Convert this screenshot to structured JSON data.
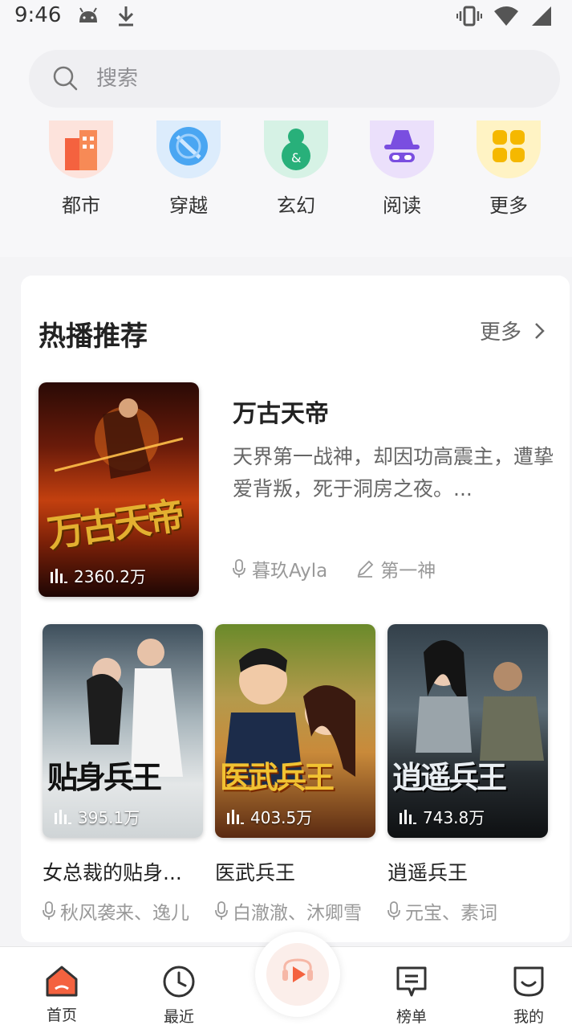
{
  "status_bar": {
    "time": "9:46"
  },
  "search": {
    "placeholder": "搜索"
  },
  "categories": [
    {
      "label": "都市",
      "icon": "city-building-icon",
      "color": "#f4623f"
    },
    {
      "label": "穿越",
      "icon": "time-travel-swirl-icon",
      "color": "#3f9ef0"
    },
    {
      "label": "玄幻",
      "icon": "gourd-icon",
      "color": "#28b07a"
    },
    {
      "label": "阅读",
      "icon": "spy-hat-icon",
      "color": "#7a4ee0"
    },
    {
      "label": "更多",
      "icon": "more-grid-icon",
      "color": "#f5b800"
    }
  ],
  "hot": {
    "title": "热播推荐",
    "more_label": "更多",
    "featured": {
      "title": "万古天帝",
      "description": "天界第一战神，却因功高震主，遭挚爱背叛，死于洞房之夜。...",
      "play_count": "2360.2万",
      "narrator": "暮玖Ayla",
      "author": "第一神"
    },
    "books": [
      {
        "title": "女总裁的贴身...",
        "play_count": "395.1万",
        "authors": "秋风袭来、逸儿"
      },
      {
        "title": "医武兵王",
        "play_count": "403.5万",
        "authors": "白澈澈、沐卿雪"
      },
      {
        "title": "逍遥兵王",
        "play_count": "743.8万",
        "authors": "元宝、素词"
      }
    ]
  },
  "bottom_nav": [
    {
      "label": "首页",
      "active": true
    },
    {
      "label": "最近"
    },
    {
      "label": "榜单"
    },
    {
      "label": "我的"
    }
  ],
  "colors": {
    "accent": "#f4623f",
    "text_primary": "#222222",
    "text_secondary": "#999999"
  }
}
